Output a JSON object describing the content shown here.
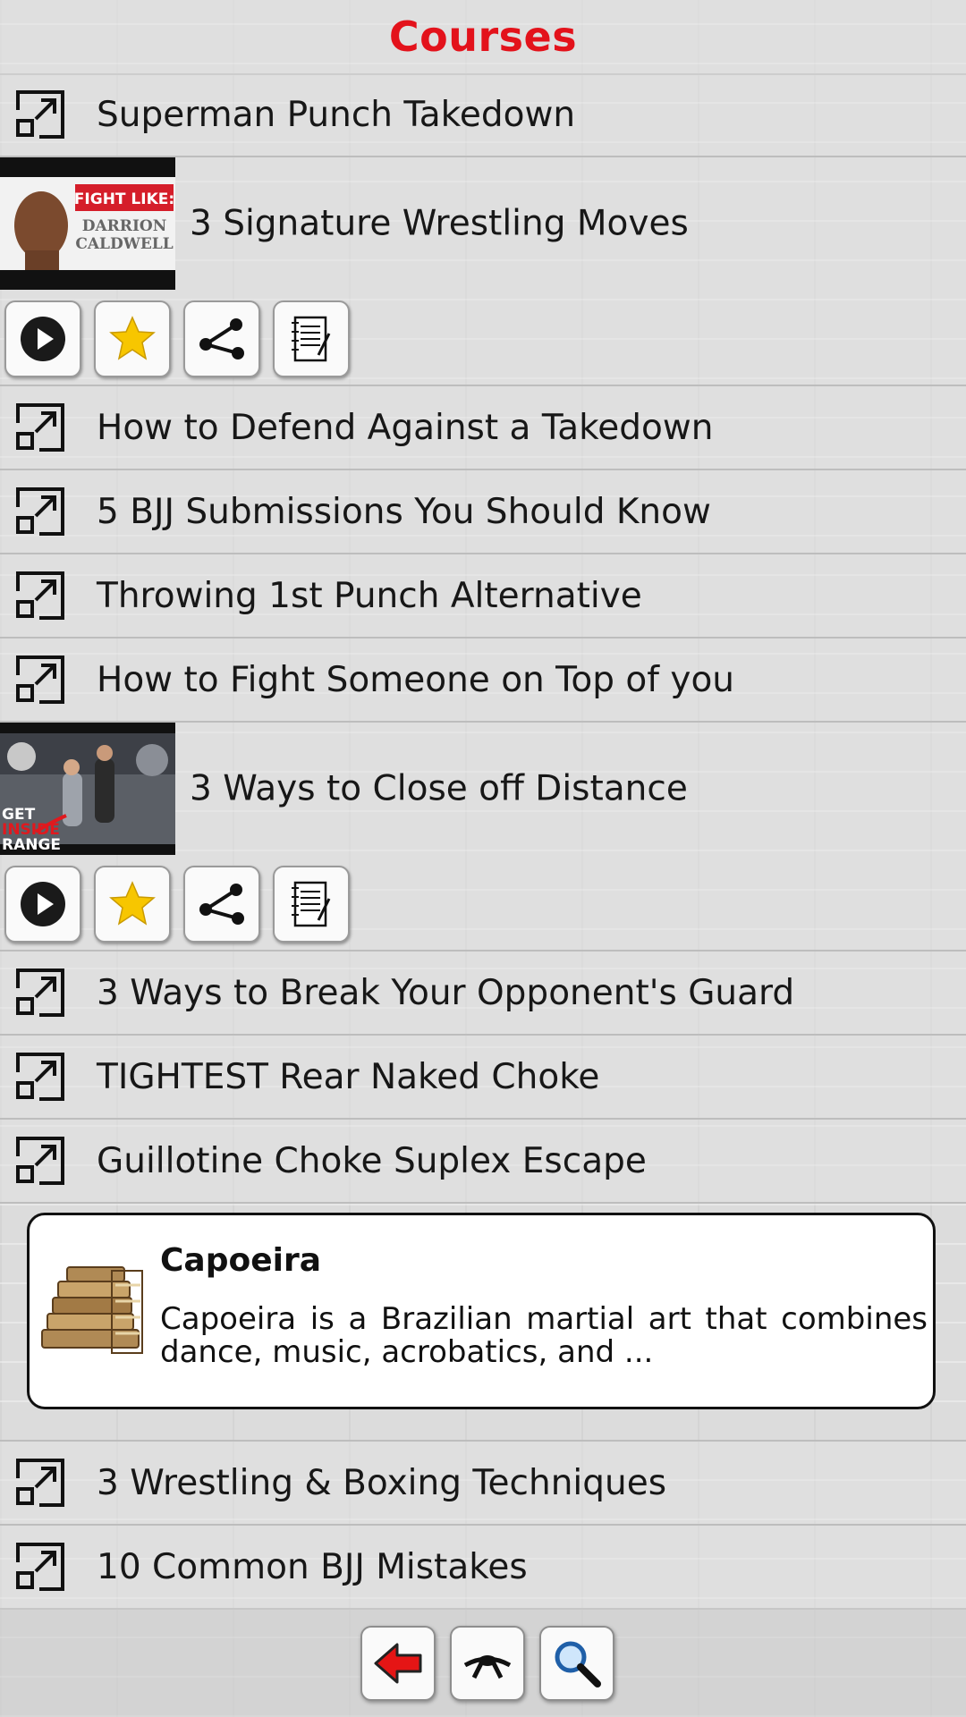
{
  "header": {
    "title": "Courses"
  },
  "items": [
    {
      "label": "Superman Punch Takedown"
    },
    {
      "label": "3 Signature Wrestling Moves",
      "thumbnail": {
        "line1": "FIGHT LIKE:",
        "line2": "DARRION",
        "line3": "CALDWELL"
      }
    },
    {
      "label": "How to Defend Against a Takedown"
    },
    {
      "label": "5 BJJ Submissions You Should Know"
    },
    {
      "label": "Throwing 1st Punch Alternative"
    },
    {
      "label": "How to Fight Someone on Top of you"
    },
    {
      "label": "3 Ways to Close off Distance",
      "thumbnail": {
        "line1": "GET",
        "line2": "INSIDE",
        "line3": "RANGE"
      }
    },
    {
      "label": "3 Ways to Break Your Opponent's Guard"
    },
    {
      "label": "TIGHTEST Rear Naked Choke"
    },
    {
      "label": "Guillotine Choke Suplex Escape"
    },
    {
      "label": "3 Wrestling & Boxing Techniques"
    },
    {
      "label": "10 Common BJJ Mistakes"
    }
  ],
  "card": {
    "title": "Capoeira",
    "description": "Capoeira is a Brazilian martial art that combines dance, music, acrobatics, and ..."
  },
  "icons": {
    "row": "external-link-icon",
    "actions": [
      "play-icon",
      "star-icon",
      "share-icon",
      "notes-icon"
    ],
    "nav": [
      "back-arrow-icon",
      "belt-icon",
      "search-icon"
    ]
  },
  "colors": {
    "title": "#e3121b",
    "star": "#f7c600",
    "back_arrow": "#e51515"
  }
}
